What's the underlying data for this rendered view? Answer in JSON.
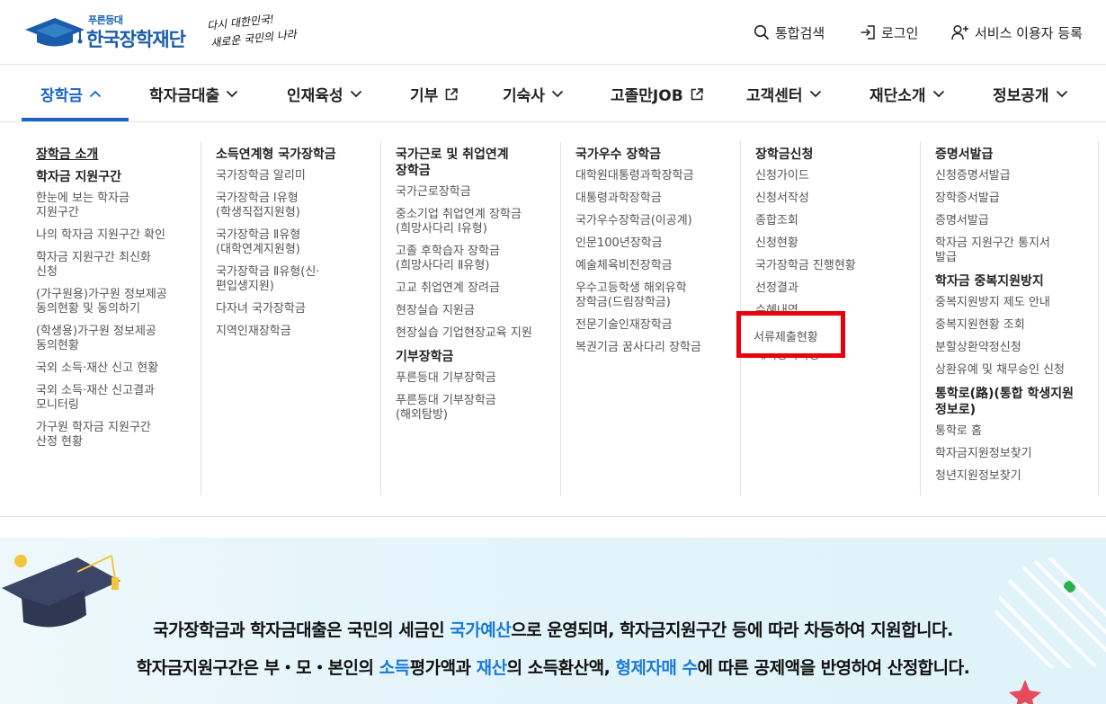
{
  "header": {
    "logo_small": "푸른등대",
    "logo_name": "한국장학재단",
    "slogan_line1": "다시 대한민국!",
    "slogan_line2": "새로운 국민의 나라",
    "util": {
      "search": "통합검색",
      "login": "로그인",
      "register": "서비스 이용자 등록"
    }
  },
  "gnb": {
    "items": [
      {
        "label": "장학금",
        "active": true,
        "icon": "chevron-up-icon"
      },
      {
        "label": "학자금대출",
        "icon": "chevron-down-icon"
      },
      {
        "label": "인재육성",
        "icon": "chevron-down-icon"
      },
      {
        "label": "기부",
        "icon": "external-link-icon"
      },
      {
        "label": "기숙사",
        "icon": "chevron-down-icon"
      },
      {
        "label": "고졸만JOB",
        "icon": "external-link-icon"
      },
      {
        "label": "고객센터",
        "icon": "chevron-down-icon"
      },
      {
        "label": "재단소개",
        "icon": "chevron-down-icon"
      },
      {
        "label": "정보공개",
        "icon": "chevron-down-icon"
      }
    ]
  },
  "mega": {
    "col1": {
      "h1": "장학금 소개",
      "h2": "학자금 지원구간",
      "items": [
        "한눈에 보는 학자금\n지원구간",
        "나의 학자금 지원구간 확인",
        "학자금 지원구간 최신화\n신청",
        "(가구원용)가구원 정보제공\n동의현황 및 동의하기",
        "(학생용)가구원 정보제공\n동의현황",
        "국외 소득·재산 신고 현황",
        "국외 소득·재산 신고결과\n모니터링",
        "가구원 학자금 지원구간\n산정 현황"
      ]
    },
    "col2": {
      "h1": "소득연계형 국가장학금",
      "items": [
        "국가장학금 알리미",
        "국가장학금 Ⅰ유형\n(학생직접지원형)",
        "국가장학금 Ⅱ유형\n(대학연계지원형)",
        "국가장학금 Ⅱ유형(신·\n편입생지원)",
        "다자녀 국가장학금",
        "지역인재장학금"
      ]
    },
    "col3": {
      "h1": "국가근로 및 취업연계\n장학금",
      "items": [
        "국가근로장학금",
        "중소기업 취업연계 장학금\n(희망사다리 Ⅰ유형)",
        "고졸 후학습자 장학금\n(희망사다리 Ⅱ유형)",
        "고교 취업연계 장려금",
        "현장실습 지원금",
        "현장실습 기업현장교육 지원"
      ],
      "h2": "기부장학금",
      "items2": [
        "푸른등대 기부장학금",
        "푸른등대 기부장학금\n(해외탐방)"
      ]
    },
    "col4": {
      "h1": "국가우수 장학금",
      "items": [
        "대학원대통령과학장학금",
        "대통령과학장학금",
        "국가우수장학금(이공계)",
        "인문100년장학금",
        "예술체육비전장학금",
        "우수고등학생 해외유학\n장학금(드림장학금)",
        "전문기술인재장학금",
        "복권기금 꿈사다리 장학금"
      ]
    },
    "col5": {
      "h1": "장학금신청",
      "items": [
        "신청가이드",
        "신청서작성",
        "종합조회",
        "신청현황",
        "국가장학금 진행현황",
        "선정결과",
        "수혜내역",
        "서류제출현황",
        "해외장학사항"
      ],
      "highlighted": "서류제출현황"
    },
    "col6": {
      "h1": "증명서발급",
      "items": [
        "신청증명서발급",
        "장학증서발급",
        "증명서발급",
        "학자금 지원구간 통지서\n발급"
      ],
      "h2": "학자금 중복지원방지",
      "items2": [
        "중복지원방지 제도 안내",
        "중복지원현황 조회",
        "분할상환약정신청",
        "상환유예 및 채무승인 신청"
      ],
      "h3": "통학로(路)(통합 학생지원\n정보로)",
      "items3": [
        "통학로 홈",
        "학자금지원정보찾기",
        "청년지원정보찾기"
      ]
    }
  },
  "banner": {
    "l1_a": "국가장학금과 학자금대출은 국민의 세금인 ",
    "l1_b": "국가예산",
    "l1_c": "으로 운영되며, 학자금지원구간 등에 따라 차등하여 지원합니다.",
    "l2_a": "학자금지원구간은 부・모・본인의 ",
    "l2_b": "소득",
    "l2_c": "평가액과 ",
    "l2_d": "재산",
    "l2_e": "의 소득환산액, ",
    "l2_f": "형제자매 수",
    "l2_g": "에 따른 공제액을 반영하여 산정합니다."
  },
  "colors": {
    "primary": "#1a64c8",
    "highlight_border": "#e8000b",
    "banner_emph": "#1a7ad8"
  }
}
